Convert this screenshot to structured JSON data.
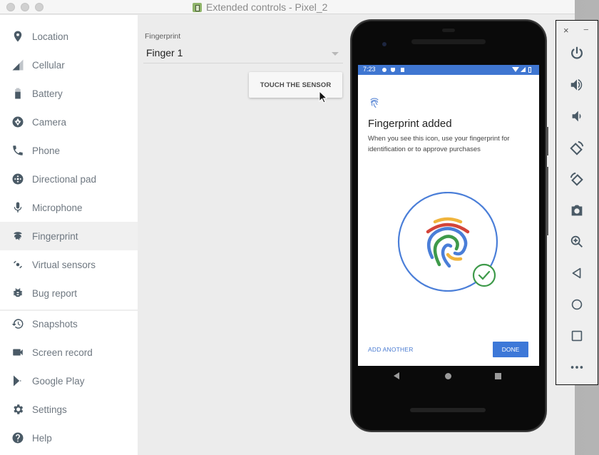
{
  "window": {
    "title": "Extended controls - Pixel_2"
  },
  "sidebar": {
    "items": [
      {
        "id": "location",
        "label": "Location",
        "icon": "location-pin-icon"
      },
      {
        "id": "cellular",
        "label": "Cellular",
        "icon": "signal-icon"
      },
      {
        "id": "battery",
        "label": "Battery",
        "icon": "battery-icon"
      },
      {
        "id": "camera",
        "label": "Camera",
        "icon": "camera-aperture-icon"
      },
      {
        "id": "phone",
        "label": "Phone",
        "icon": "phone-icon"
      },
      {
        "id": "dpad",
        "label": "Directional pad",
        "icon": "dpad-icon"
      },
      {
        "id": "microphone",
        "label": "Microphone",
        "icon": "microphone-icon"
      },
      {
        "id": "fingerprint",
        "label": "Fingerprint",
        "icon": "fingerprint-icon",
        "active": true
      },
      {
        "id": "virtual-sensors",
        "label": "Virtual sensors",
        "icon": "rotation-icon"
      },
      {
        "id": "bug-report",
        "label": "Bug report",
        "icon": "bug-icon"
      },
      {
        "id": "snapshots",
        "label": "Snapshots",
        "icon": "history-icon"
      },
      {
        "id": "screen-record",
        "label": "Screen record",
        "icon": "videocam-icon"
      },
      {
        "id": "google-play",
        "label": "Google Play",
        "icon": "play-store-icon"
      },
      {
        "id": "settings",
        "label": "Settings",
        "icon": "gear-icon"
      },
      {
        "id": "help",
        "label": "Help",
        "icon": "help-icon"
      }
    ]
  },
  "fingerprint_panel": {
    "field_label": "Fingerprint",
    "selected_finger": "Finger 1",
    "touch_button": "TOUCH THE SENSOR"
  },
  "device": {
    "status_bar": {
      "time": "7:23",
      "color": "#3f76d1"
    },
    "screen": {
      "title": "Fingerprint added",
      "description": "When you see this icon, use your fingerprint for identification or to approve purchases",
      "add_another": "ADD ANOTHER",
      "done": "DONE",
      "accent": "#3d78d8"
    }
  },
  "toolbar": {
    "close": "×",
    "minimize": "−",
    "buttons": [
      {
        "id": "power",
        "icon": "power-icon"
      },
      {
        "id": "volume-up",
        "icon": "volume-up-icon"
      },
      {
        "id": "volume-down",
        "icon": "volume-down-icon"
      },
      {
        "id": "rotate-left",
        "icon": "rotate-left-icon"
      },
      {
        "id": "rotate-right",
        "icon": "rotate-right-icon"
      },
      {
        "id": "screenshot",
        "icon": "camera-icon"
      },
      {
        "id": "zoom",
        "icon": "zoom-in-icon"
      },
      {
        "id": "back",
        "icon": "back-icon"
      },
      {
        "id": "home",
        "icon": "home-icon"
      },
      {
        "id": "overview",
        "icon": "overview-icon"
      },
      {
        "id": "more",
        "icon": "more-icon"
      }
    ]
  }
}
